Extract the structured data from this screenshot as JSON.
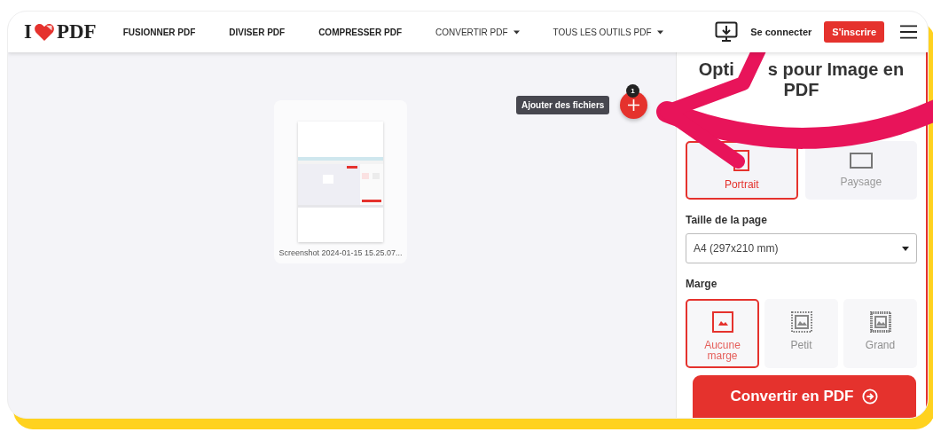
{
  "header": {
    "logo": {
      "left": "I",
      "right": "PDF"
    },
    "nav": [
      {
        "label": "FUSIONNER PDF",
        "dropdown": false
      },
      {
        "label": "DIVISER PDF",
        "dropdown": false
      },
      {
        "label": "COMPRESSER PDF",
        "dropdown": false
      },
      {
        "label": "CONVERTIR PDF",
        "dropdown": true
      },
      {
        "label": "TOUS LES OUTILS PDF",
        "dropdown": true
      }
    ],
    "login": "Se connecter",
    "signup": "S'inscrire"
  },
  "files": [
    {
      "name": "Screenshot 2024-01-15 15.25.07..."
    }
  ],
  "add_files": {
    "tooltip": "Ajouter des fichiers",
    "count": "1"
  },
  "sidebar": {
    "title": [
      "Opti",
      "s pour Image en",
      "PDF"
    ],
    "orientation": [
      {
        "label": "Portrait",
        "kind": "portrait",
        "selected": true
      },
      {
        "label": "Paysage",
        "kind": "landscape",
        "selected": false
      }
    ],
    "page_size": {
      "label": "Taille de la page",
      "value": "A4 (297x210 mm)"
    },
    "margin": {
      "label": "Marge",
      "options": [
        {
          "label": "Aucune marge",
          "kind": "none",
          "selected": true
        },
        {
          "label": "Petit",
          "kind": "small",
          "selected": false
        },
        {
          "label": "Grand",
          "kind": "big",
          "selected": false
        }
      ]
    },
    "convert_button": "Convertir en PDF"
  }
}
